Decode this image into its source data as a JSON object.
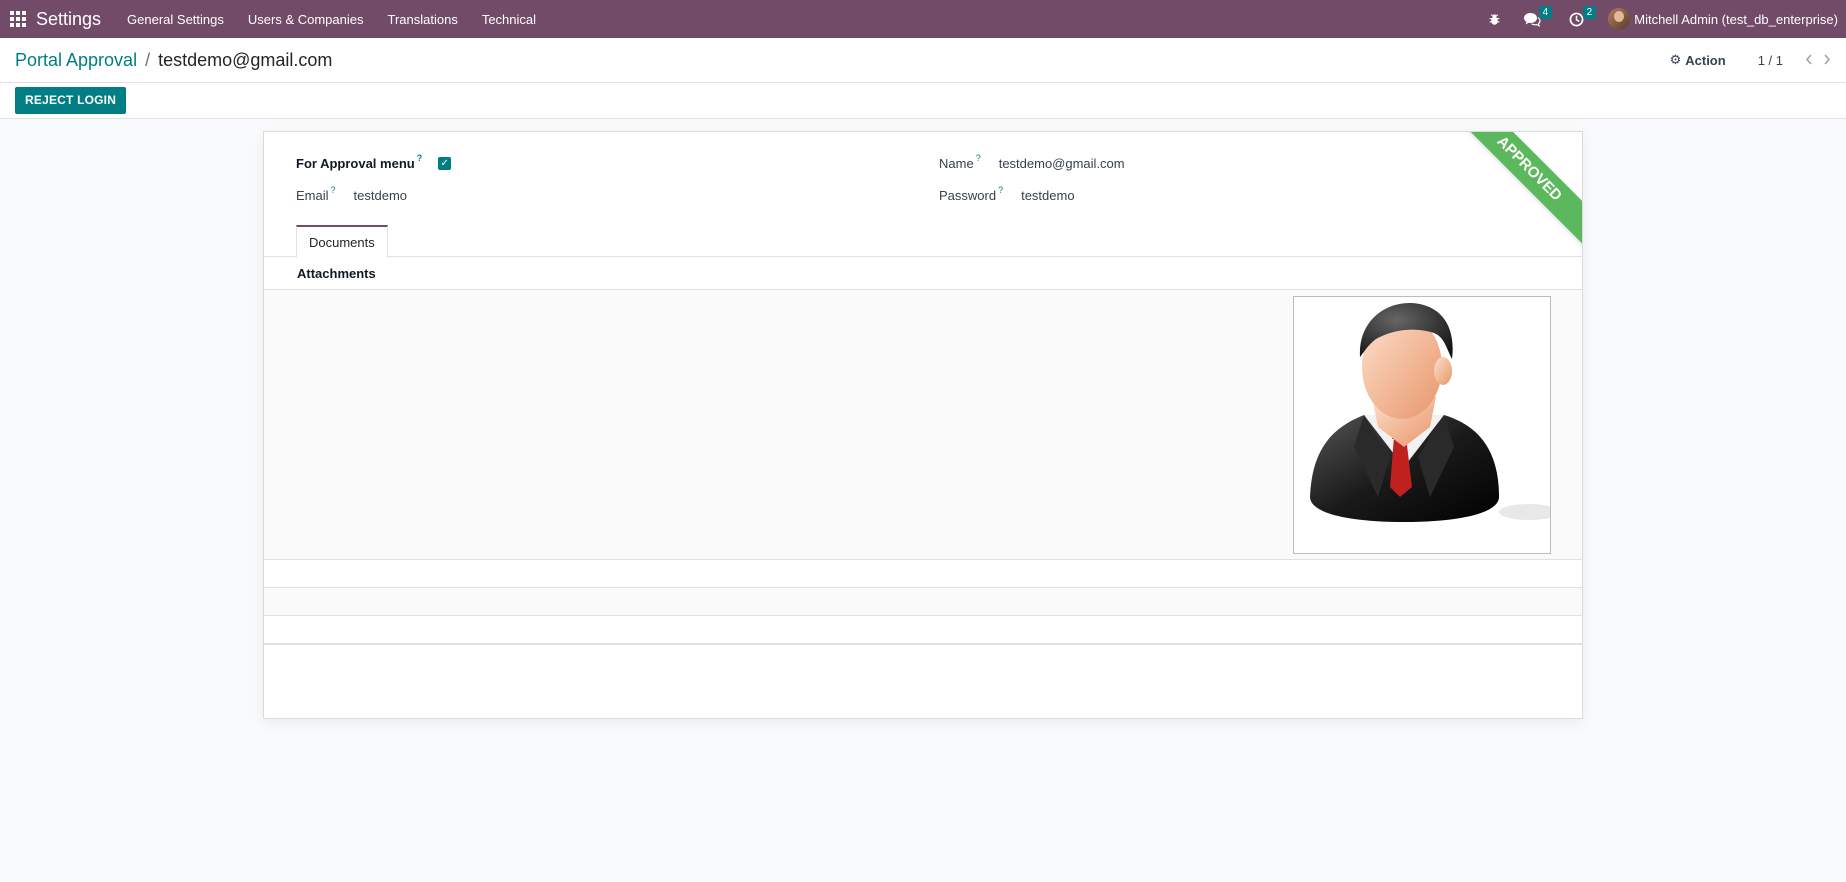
{
  "navbar": {
    "app_name": "Settings",
    "menu": [
      "General Settings",
      "Users & Companies",
      "Translations",
      "Technical"
    ],
    "messages_count": "4",
    "activities_count": "2",
    "user_name": "Mitchell Admin (test_db_enterprise)"
  },
  "breadcrumb": {
    "parent": "Portal Approval",
    "separator": "/",
    "current": "testdemo@gmail.com"
  },
  "control": {
    "action_label": "Action",
    "pager": "1 / 1"
  },
  "statusbar": {
    "reject_label": "REJECT LOGIN"
  },
  "form": {
    "ribbon": "APPROVED",
    "for_approval_label": "For Approval menu",
    "for_approval_checked": true,
    "email_label": "Email",
    "email_value": "testdemo",
    "name_label": "Name",
    "name_value": "testdemo@gmail.com",
    "password_label": "Password",
    "password_value": "testdemo",
    "help_mark": "?",
    "tab_documents": "Documents",
    "attachments_label": "Attachments"
  },
  "colors": {
    "navbar": "#714b67",
    "primary": "#017e84",
    "ribbon": "#5cb85c"
  }
}
